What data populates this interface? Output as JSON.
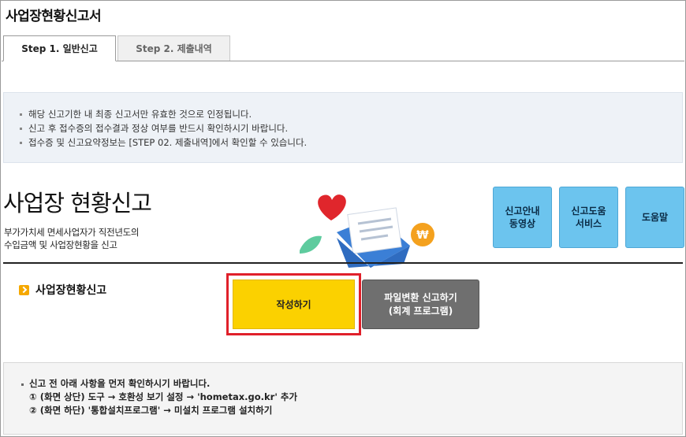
{
  "window": {
    "title": "사업장현황신고서"
  },
  "tabs": [
    {
      "label": "Step 1. 일반신고",
      "active": true
    },
    {
      "label": "Step 2. 제출내역",
      "active": false
    }
  ],
  "notice": [
    "해당 신고기한 내 최종 신고서만 유효한 것으로 인정됩니다.",
    "신고 후 접수증의 접수결과 정상 여부를 반드시 확인하시기 바랍니다.",
    "접수증 및 신고요약정보는 [STEP 02. 제출내역]에서 확인할 수 있습니다."
  ],
  "hero": {
    "title": "사업장 현황신고",
    "desc_line1": "부가가치세 면세사업자가 직전년도의",
    "desc_line2": "수입금액 및 사업장현황을 신고"
  },
  "service_buttons": [
    {
      "label": "신고안내\n동영상"
    },
    {
      "label": "신고도움\n서비스"
    },
    {
      "label": "도움말"
    }
  ],
  "section": {
    "label": "사업장현황신고",
    "write_button": "작성하기",
    "convert_button": "파일변환 신고하기\n(회계 프로그램)"
  },
  "footer": {
    "intro": "신고 전 아래 사항을 먼저 확인하시기 바랍니다.",
    "step1": "① (화면 상단) 도구 → 호환성 보기 설정 → 'hometax.go.kr' 추가",
    "step2": "② (화면 하단) '통합설치프로그램' → 미설치 프로그램 설치하기"
  },
  "colors": {
    "accent_blue": "#6cc4ee",
    "write_button": "#fbd100",
    "highlight_red": "#e0202a",
    "convert_button": "#6f6f6f"
  },
  "icons": {
    "hero": [
      "heart-icon",
      "envelope-icon",
      "leaf-icon",
      "won-coin-icon"
    ],
    "section": "arrow-bullet-icon"
  }
}
